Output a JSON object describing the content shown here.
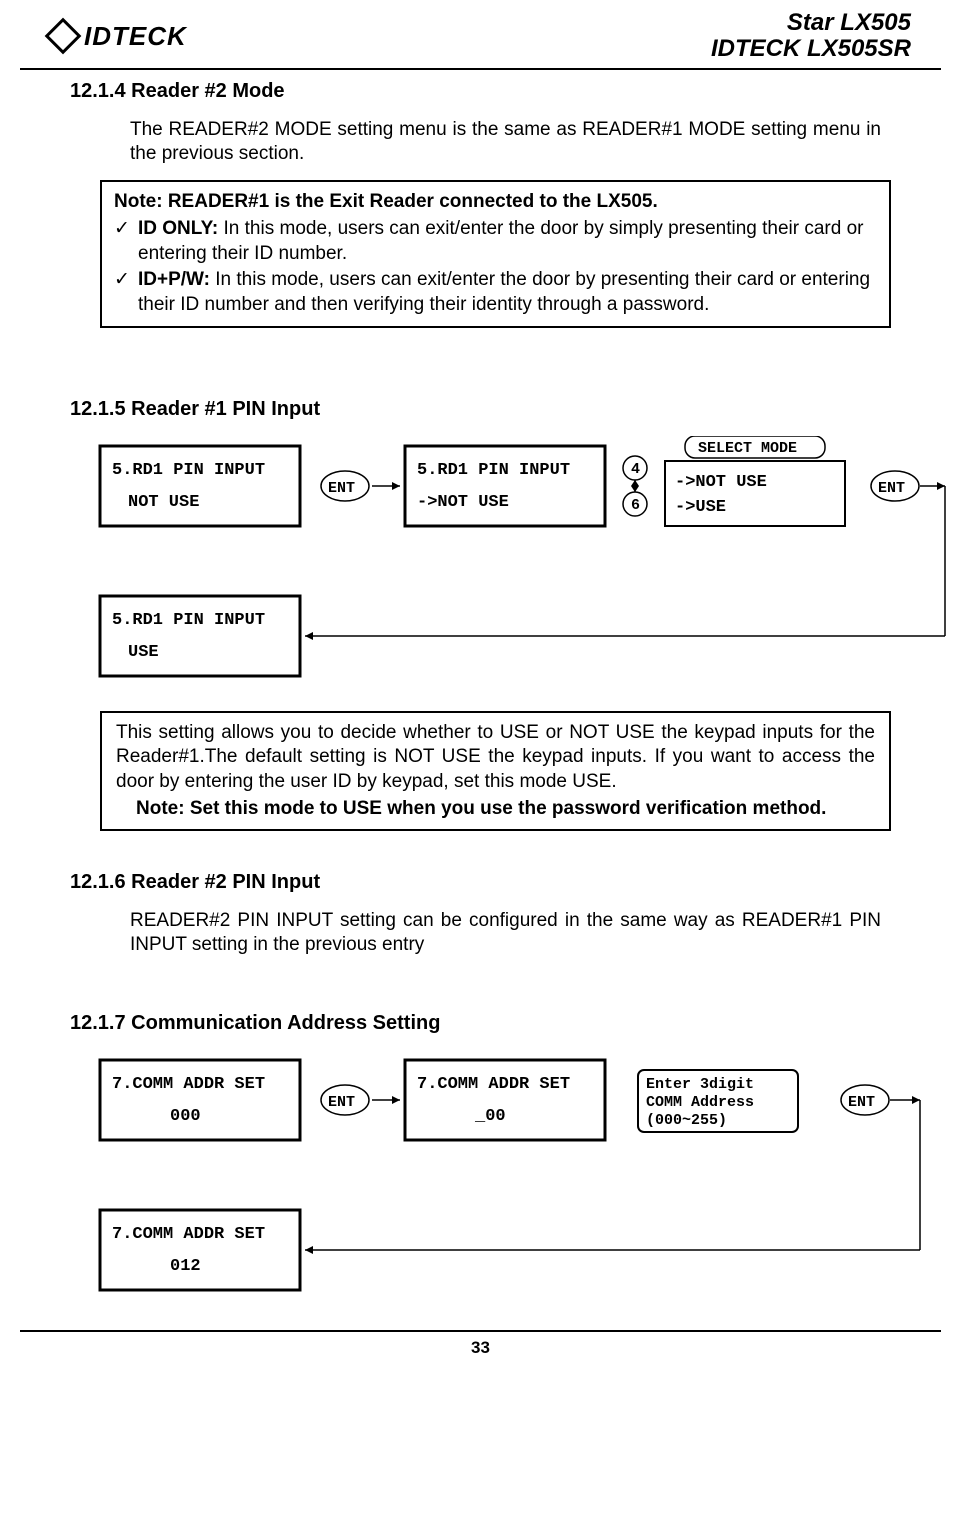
{
  "header": {
    "logo_left": "IDTECK",
    "logo_right_line1": "Star LX505",
    "logo_right_line2": "IDTECK LX505SR"
  },
  "s1": {
    "heading": "12.1.4 Reader #2 Mode",
    "body": "The READER#2 MODE setting menu is the same as READER#1 MODE setting menu in the previous section.",
    "note_title": "Note: READER#1 is the Exit Reader connected to the LX505.",
    "item1_label": "ID ONLY: ",
    "item1_desc": "In this mode, users can exit/enter the door by simply presenting their card or entering their ID number.",
    "item2_label": "ID+P/W: ",
    "item2_desc": "In this mode, users can exit/enter the door by presenting their card or entering their ID number and then verifying their identity through a password."
  },
  "s2": {
    "heading": "12.1.5 Reader #1 PIN Input",
    "diagram": {
      "box1_l1": "5.RD1 PIN INPUT",
      "box1_l2": "NOT USE",
      "ent": "ENT",
      "box2_l1": "5.RD1 PIN INPUT",
      "box2_l2": "->NOT USE",
      "k4": "4",
      "k6": "6",
      "select": "SELECT MODE",
      "opt1": "->NOT USE",
      "opt2": "->USE",
      "box3_l1": "5.RD1 PIN INPUT",
      "box3_l2": "USE"
    },
    "note_body": "This setting allows you to decide whether to USE or NOT USE the keypad inputs for the Reader#1.The default setting is NOT USE the keypad inputs. If you want to access the door by entering the user ID by keypad, set this mode USE.",
    "note_bold": "Note: Set this mode to USE when you use the password verification method."
  },
  "s3": {
    "heading": "12.1.6 Reader #2 PIN Input",
    "body": "READER#2 PIN INPUT setting can be configured in the same way as READER#1 PIN INPUT setting in the previous entry"
  },
  "s4": {
    "heading": "12.1.7 Communication Address Setting",
    "diagram": {
      "box1_l1": "7.COMM ADDR SET",
      "box1_l2": "000",
      "ent": "ENT",
      "box2_l1": "7.COMM ADDR SET",
      "box2_l2": "_00",
      "hint_l1": "Enter 3digit",
      "hint_l2": "COMM Address",
      "hint_l3": "(000~255)",
      "box3_l1": "7.COMM ADDR SET",
      "box3_l2": "012"
    }
  },
  "footer": {
    "page": "33"
  }
}
